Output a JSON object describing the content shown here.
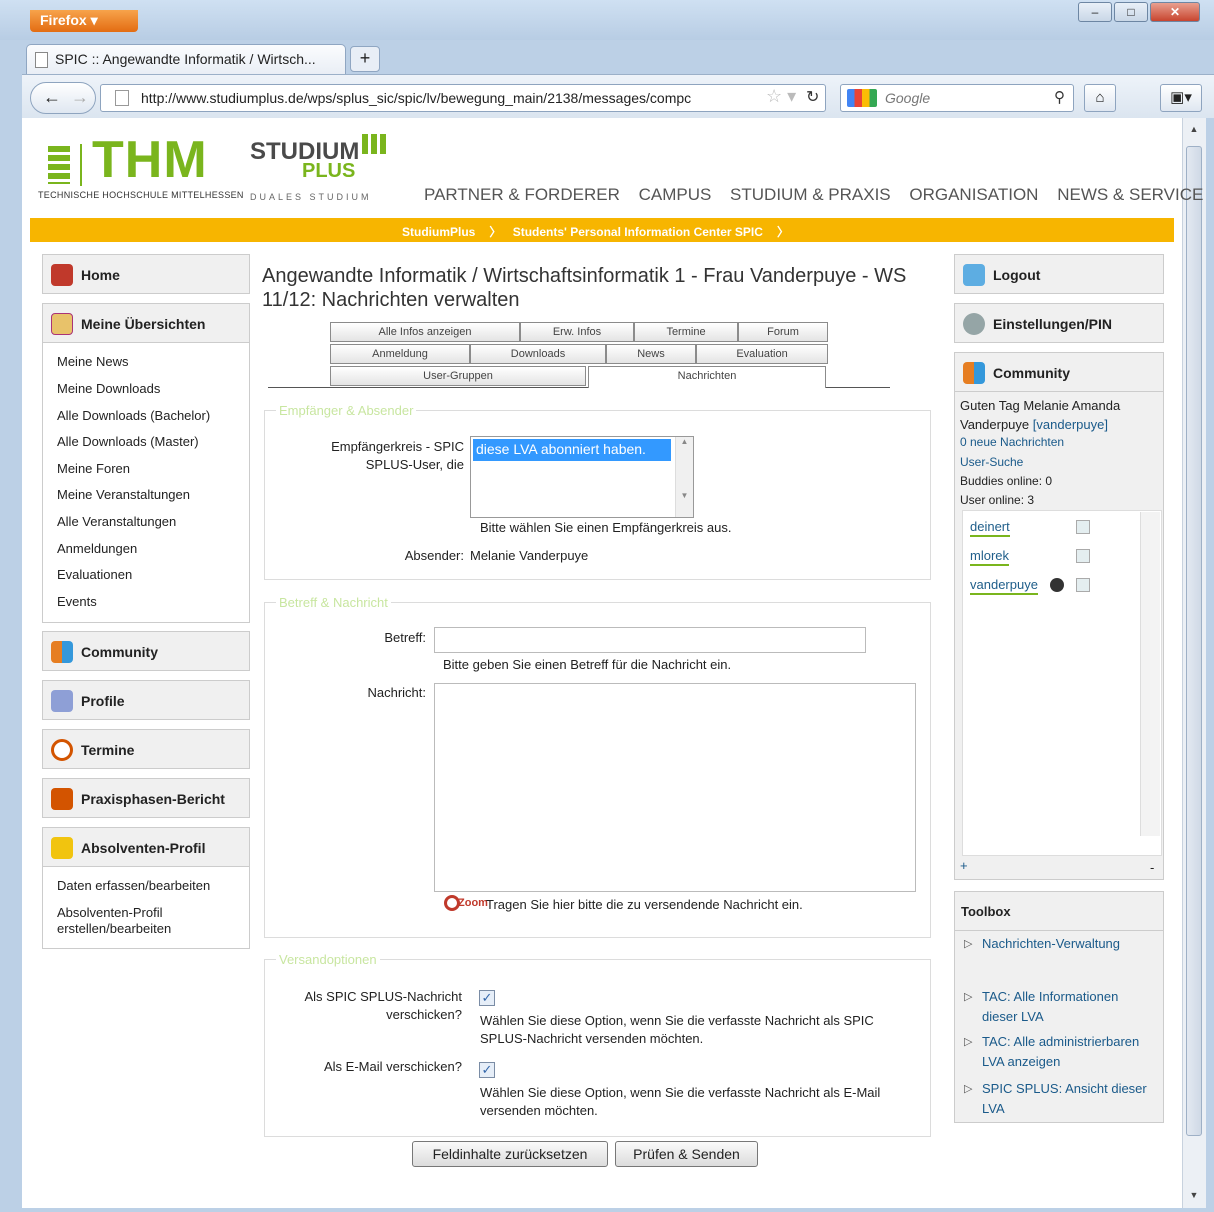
{
  "browser": {
    "menu_button": "Firefox ▾",
    "tab_title": "SPIC :: Angewandte Informatik / Wirtsch...",
    "new_tab": "+",
    "url": "http://www.studiumplus.de/wps/splus_sic/spic/lv/bewegung_main/2138/messages/compc",
    "search_placeholder": "Google",
    "win_min": "–",
    "win_max": "□",
    "win_close": "✕"
  },
  "header": {
    "thm_logo": "THM",
    "thm_subtitle": "TECHNISCHE HOCHSCHULE MITTELHESSEN",
    "splus_line1": "STUDIUM",
    "splus_line2": "PLUS",
    "splus_line3": "DUALES STUDIUM",
    "nav": [
      "PARTNER & FORDERER",
      "CAMPUS",
      "STUDIUM & PRAXIS",
      "ORGANISATION",
      "NEWS & SERVICE"
    ],
    "breadcrumb": [
      "StudiumPlus",
      "Students' Personal Information Center SPIC"
    ]
  },
  "left_sidebar": {
    "home": "Home",
    "uebersichten": "Meine Übersichten",
    "uebersichten_links": [
      "Meine News",
      "Meine Downloads",
      "Alle Downloads (Bachelor)",
      "Alle Downloads (Master)",
      "Meine Foren",
      "Meine Veranstaltungen",
      "Alle Veranstaltungen",
      "Anmeldungen",
      "Evaluationen",
      "Events"
    ],
    "community": "Community",
    "profile": "Profile",
    "termine": "Termine",
    "praxis": "Praxisphasen-Bericht",
    "absolventen": "Absolventen-Profil",
    "absolventen_links": [
      "Daten erfassen/bearbeiten",
      "Absolventen-Profil erstellen/bearbeiten"
    ]
  },
  "main": {
    "title": "Angewandte Informatik / Wirtschaftsinformatik 1 - Frau Vanderpuye - WS 11/12: Nachrichten verwalten",
    "tabs_row1": [
      "Alle Infos anzeigen",
      "Erw. Infos",
      "Termine",
      "Forum"
    ],
    "tabs_row2": [
      "Anmeldung",
      "Downloads",
      "News",
      "Evaluation"
    ],
    "tabs_row3": [
      "User-Gruppen",
      "Nachrichten"
    ],
    "section1_legend": "Empfänger & Absender",
    "empfaenger_label": "Empfängerkreis - SPIC SPLUS-User, die",
    "empfaenger_option": "diese LVA abonniert haben.",
    "empfaenger_hint": "Bitte wählen Sie einen Empfängerkreis aus.",
    "absender_label": "Absender:",
    "absender_value": "Melanie Vanderpuye",
    "section2_legend": "Betreff & Nachricht",
    "betreff_label": "Betreff:",
    "betreff_hint": "Bitte geben Sie einen Betreff für die Nachricht ein.",
    "nachricht_label": "Nachricht:",
    "zoom_label": "Zoom",
    "nachricht_hint": "Tragen Sie hier bitte die zu versendende Nachricht ein.",
    "section3_legend": "Versandoptionen",
    "opt1_label": "Als SPIC SPLUS-Nachricht verschicken?",
    "opt1_hint": "Wählen Sie diese Option, wenn Sie die verfasste Nachricht als SPIC SPLUS-Nachricht versenden möchten.",
    "opt2_label": "Als E-Mail verschicken?",
    "opt2_hint": "Wählen Sie diese Option, wenn Sie die verfasste Nachricht als E-Mail versenden möchten.",
    "reset_button": "Feldinhalte zurücksetzen",
    "submit_button": "Prüfen & Senden"
  },
  "right_sidebar": {
    "logout": "Logout",
    "settings": "Einstellungen/PIN",
    "community": "Community",
    "greeting": "Guten Tag Melanie Amanda Vanderpuye",
    "greeting_user": "[vanderpuye]",
    "new_messages": "0 neue Nachrichten",
    "user_search": "User-Suche",
    "buddies": "Buddies online: 0",
    "users_online": "User online: 3",
    "online_users": [
      "deinert",
      "mlorek",
      "vanderpuye"
    ],
    "plus": "+",
    "minus": "-",
    "toolbox": "Toolbox",
    "toolbox_items": [
      "Nachrichten-Verwaltung",
      "TAC: Alle Informationen dieser LVA",
      "TAC: Alle administrierbaren LVA anzeigen",
      "SPIC SPLUS: Ansicht dieser LVA"
    ]
  },
  "colors": {
    "accent_orange": "#f7b500",
    "thm_green": "#7ab51d",
    "link_blue": "#1a5a8a"
  }
}
